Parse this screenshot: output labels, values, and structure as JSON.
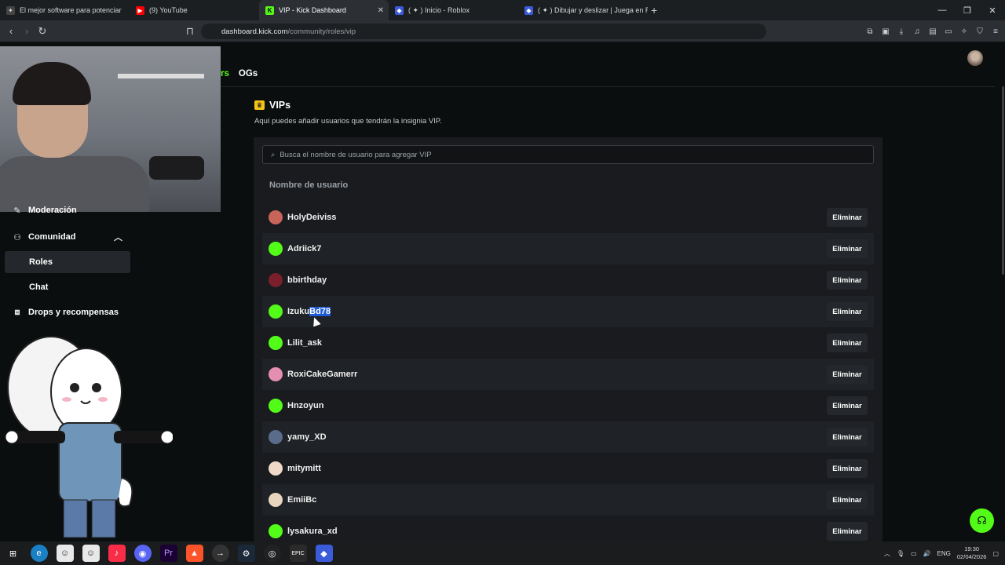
{
  "browser": {
    "tabs": [
      {
        "title": "El mejor software para potenciar",
        "favicon_color": "#cfcfcf",
        "favicon_glyph": "✦",
        "active": false
      },
      {
        "title": "(9) YouTube",
        "favicon_color": "#ff0000",
        "favicon_glyph": "▶",
        "active": false
      },
      {
        "title": "VIP - Kick Dashboard",
        "favicon_color": "#53fc18",
        "favicon_glyph": "K",
        "active": true
      },
      {
        "title": "( ✦ ) Inicio - Roblox",
        "favicon_color": "#3b5bdb",
        "favicon_glyph": "◆",
        "active": false
      },
      {
        "title": "( ✦ ) Dibujar y deslizar | Juega en Ro",
        "favicon_color": "#3b5bdb",
        "favicon_glyph": "◆",
        "active": false
      }
    ],
    "url_host": "dashboard.kick.com",
    "url_path": "/community/roles/vip"
  },
  "page": {
    "subtabs": [
      {
        "label": "rs",
        "active": true
      },
      {
        "label": "OGs",
        "active": false
      }
    ],
    "sidebar": {
      "moderacion": "Moderación",
      "comunidad": "Comunidad",
      "roles": "Roles",
      "chat": "Chat",
      "drops": "Drops y recompensas"
    },
    "vip": {
      "title": "VIPs",
      "description": "Aquí puedes añadir usuarios que tendrán la insignia VIP.",
      "search_placeholder": "Busca el nombre de usuario para agregar VIP",
      "column_header": "Nombre de usuario",
      "remove_label": "Eliminar",
      "users": [
        {
          "name": "HolyDeiviss",
          "avatar_color": "#c8655a"
        },
        {
          "name": "Adriick7",
          "avatar_color": "#53fc18"
        },
        {
          "name": "bbirthday",
          "avatar_color": "#7a1f2b"
        },
        {
          "name": "IzukuBd78",
          "avatar_color": "#53fc18",
          "selected_prefix": "Izuku",
          "selected_text": "Bd78"
        },
        {
          "name": "Lilit_ask",
          "avatar_color": "#53fc18"
        },
        {
          "name": "RoxiCakeGamerr",
          "avatar_color": "#e48fb0"
        },
        {
          "name": "Hnzoyun",
          "avatar_color": "#53fc18"
        },
        {
          "name": "yamy_XD",
          "avatar_color": "#5a6b8c"
        },
        {
          "name": "mitymitt",
          "avatar_color": "#f0d9c8"
        },
        {
          "name": "EmiiBc",
          "avatar_color": "#e8d5c0"
        },
        {
          "name": "lysakura_xd",
          "avatar_color": "#53fc18"
        }
      ]
    }
  },
  "taskbar": {
    "lang": "ENG",
    "time": "19:30",
    "date": "02/04/2026"
  }
}
